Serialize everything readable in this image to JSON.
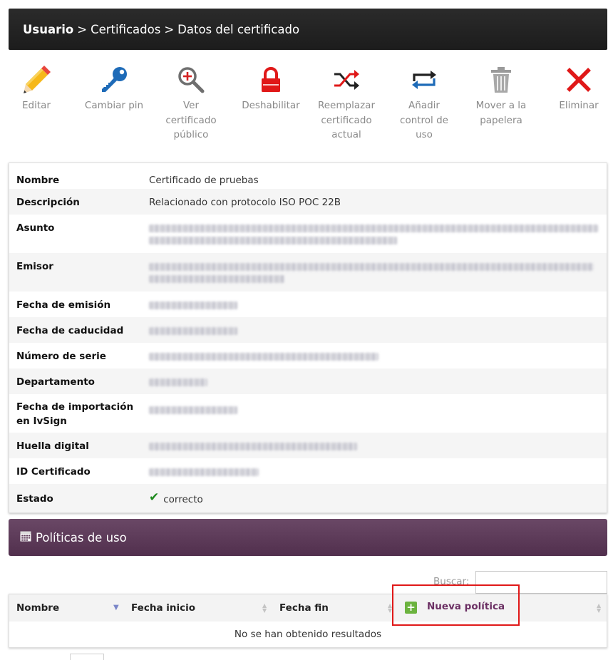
{
  "breadcrumb": {
    "user": "Usuario",
    "separator": ">",
    "certificates": "Certificados",
    "current": "Datos del certificado"
  },
  "toolbar": [
    {
      "name": "edit",
      "label": "Editar",
      "icon": "pencil-icon"
    },
    {
      "name": "change-pin",
      "label": "Cambiar pin",
      "icon": "key-icon"
    },
    {
      "name": "view-public-cert",
      "label": "Ver certificado público",
      "icon": "magnifier-plus-icon"
    },
    {
      "name": "disable",
      "label": "Deshabilitar",
      "icon": "lock-icon"
    },
    {
      "name": "replace-cert",
      "label": "Reemplazar certificado actual",
      "icon": "shuffle-icon"
    },
    {
      "name": "add-usage-control",
      "label": "Añadir control de uso",
      "icon": "repeat-icon"
    },
    {
      "name": "move-to-trash",
      "label": "Mover a la papelera",
      "icon": "trash-icon"
    },
    {
      "name": "delete",
      "label": "Eliminar",
      "icon": "close-icon"
    }
  ],
  "details": {
    "nombre": {
      "label": "Nombre",
      "value": "Certificado de pruebas"
    },
    "descripcion": {
      "label": "Descripción",
      "value": "Relacionado con protocolo ISO POC 22B"
    },
    "asunto": {
      "label": "Asunto"
    },
    "emisor": {
      "label": "Emisor"
    },
    "fecha_emision": {
      "label": "Fecha de emisión"
    },
    "fecha_caducidad": {
      "label": "Fecha de caducidad"
    },
    "numero_serie": {
      "label": "Número de serie"
    },
    "departamento": {
      "label": "Departamento"
    },
    "fecha_importacion": {
      "label": "Fecha de importación en IvSign"
    },
    "huella": {
      "label": "Huella digital"
    },
    "id_certificado": {
      "label": "ID Certificado"
    },
    "estado": {
      "label": "Estado",
      "value": "correcto"
    }
  },
  "policies": {
    "title": "Políticas de uso",
    "search_label": "Buscar:",
    "columns": {
      "nombre": "Nombre",
      "fecha_inicio": "Fecha inicio",
      "fecha_fin": "Fecha fin"
    },
    "new_policy_label": "Nueva política",
    "empty_message": "No se han obtenido resultados"
  },
  "colors": {
    "breadcrumb_bg": "#1f1f1f",
    "policies_header_bg": "#5e3c5a",
    "accent_red": "#e01818",
    "icon_blue": "#1e6bb8",
    "status_green": "#1e8a1e"
  }
}
